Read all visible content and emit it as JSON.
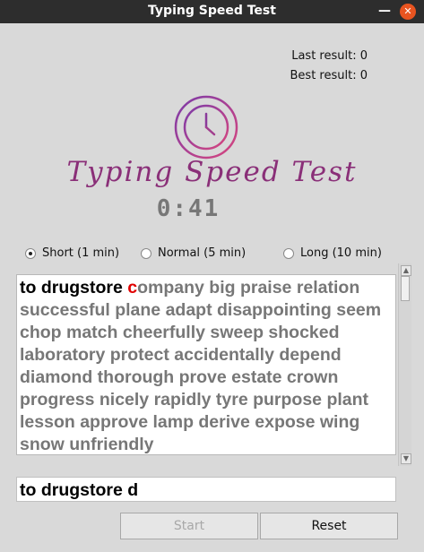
{
  "window": {
    "title": "Typing Speed Test",
    "minimize_glyph": "—",
    "close_glyph": "✕"
  },
  "results": {
    "last": "Last result: 0",
    "best": "Best result: 0"
  },
  "heading": "Typing Speed Test",
  "timer": "0:41",
  "logo_icon": "clock-icon",
  "modes": [
    {
      "label": "Short (1 min)",
      "selected": true
    },
    {
      "label": "Normal (5 min)",
      "selected": false
    },
    {
      "label": "Long (10 min)",
      "selected": false
    }
  ],
  "passage": {
    "typed": "to drugstore ",
    "current_char": "c",
    "remaining": "ompany big praise relation successful plane adapt disappointing seem chop match cheerfully sweep shocked laboratory protect accidentally depend diamond thorough prove estate crown progress nicely rapidly tyre purpose plant lesson approve lamp derive expose wing snow unfriendly"
  },
  "input_value": "to drugstore d",
  "buttons": {
    "start": "Start",
    "reset": "Reset"
  },
  "colors": {
    "accent": "#8a2f78",
    "error": "#e00000",
    "pending": "#777777"
  }
}
